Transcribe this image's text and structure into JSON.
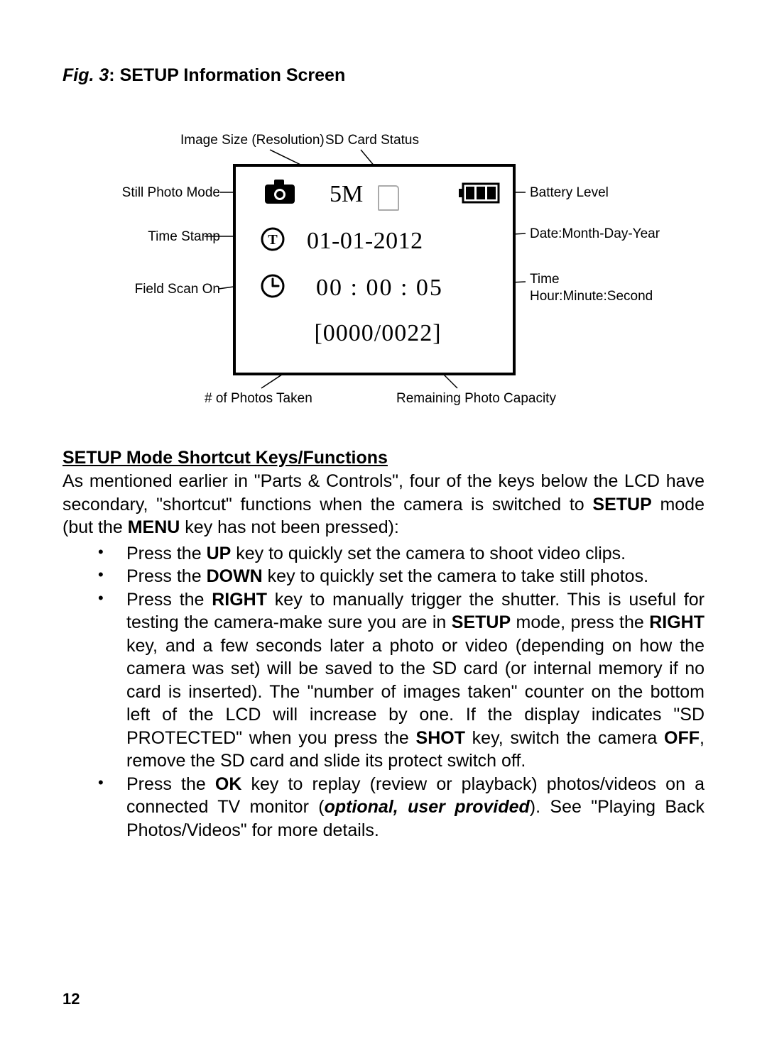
{
  "figure": {
    "label_prefix": "Fig. 3",
    "title": ": SETUP Information Screen",
    "callouts": {
      "image_size": "Image Size (Resolution)",
      "sd_status": "SD Card Status",
      "still_photo": "Still Photo Mode",
      "battery": "Battery Level",
      "time_stamp": "Time Stamp",
      "date_fmt": "Date:Month-Day-Year",
      "field_scan": "Field Scan On",
      "time_fmt_l1": "Time",
      "time_fmt_l2": "Hour:Minute:Second",
      "photos_taken": "# of Photos Taken",
      "remaining": "Remaining Photo Capacity"
    },
    "lcd": {
      "resolution": "5M",
      "date": "01-01-2012",
      "time": "00 : 00 : 05",
      "counter": "[0000/0022]"
    }
  },
  "body": {
    "subheading": "SETUP Mode Shortcut Keys/Functions",
    "intro_pre": "As mentioned earlier in \"Parts & Controls\", four of the keys below the LCD have secondary, \"shortcut\" functions when the camera is switched to ",
    "intro_setup": "SETUP",
    "intro_mid": " mode (but the ",
    "intro_menu": "MENU",
    "intro_post": " key has not been pressed):",
    "bullet1_a": "Press the ",
    "bullet1_b": "UP",
    "bullet1_c": " key to quickly set the camera to shoot video clips.",
    "bullet2_a": "Press the ",
    "bullet2_b": "DOWN",
    "bullet2_c": " key to quickly set the camera to take still photos.",
    "bullet3_a": "Press the ",
    "bullet3_b": "RIGHT",
    "bullet3_c": " key to manually trigger the shutter. This is useful for testing the camera-make sure you are in ",
    "bullet3_d": "SETUP",
    "bullet3_e": " mode, press the ",
    "bullet3_f": "RIGHT",
    "bullet3_g": " key, and a few seconds later a photo or video (depending on how the camera was set) will be saved to the SD card (or internal memory if no card is inserted). The \"number of images taken\" counter on the bottom left of the LCD will increase by one. If the display indicates \"SD PROTECTED\" when you press the ",
    "bullet3_h": "SHOT",
    "bullet3_i": " key, switch the camera ",
    "bullet3_j": "OFF",
    "bullet3_k": ", remove the SD card and slide its protect switch off.",
    "bullet4_a": "Press the ",
    "bullet4_b": "OK",
    "bullet4_c": " key to replay (review or playback) photos/videos on a connected TV monitor (",
    "bullet4_d": "optional, user provided",
    "bullet4_e": "). See \"Playing Back Photos/Videos\" for more details."
  },
  "page_number": "12"
}
